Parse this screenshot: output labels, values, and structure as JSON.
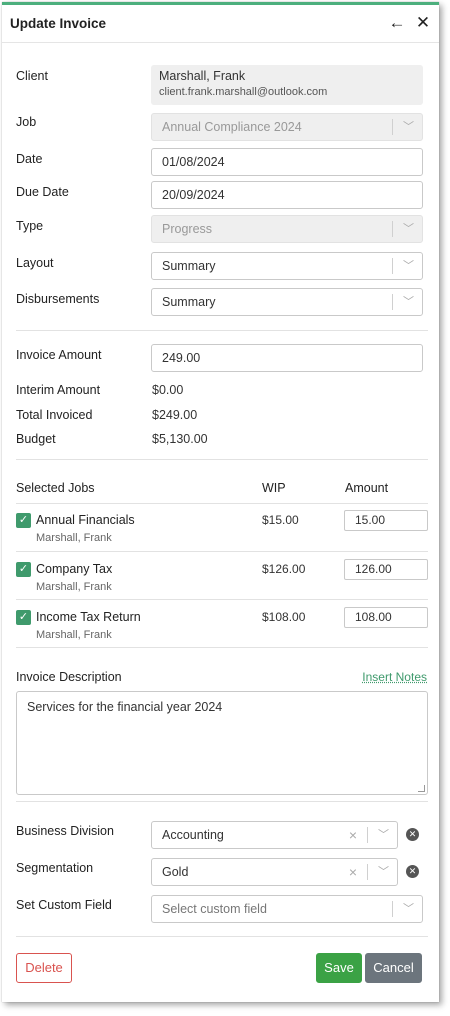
{
  "header": {
    "title": "Update Invoice",
    "back_icon": "arrow-left-icon",
    "close_icon": "close-icon"
  },
  "form": {
    "client_label": "Client",
    "client_name": "Marshall, Frank",
    "client_email": "client.frank.marshall@outlook.com",
    "job_label": "Job",
    "job_value": "Annual Compliance 2024",
    "date_label": "Date",
    "date_value": "01/08/2024",
    "due_date_label": "Due Date",
    "due_date_value": "20/09/2024",
    "type_label": "Type",
    "type_value": "Progress",
    "layout_label": "Layout",
    "layout_value": "Summary",
    "disbursements_label": "Disbursements",
    "disbursements_value": "Summary"
  },
  "amounts": {
    "invoice_amount_label": "Invoice Amount",
    "invoice_amount_value": "249.00",
    "interim_label": "Interim Amount",
    "interim_value": "$0.00",
    "total_label": "Total Invoiced",
    "total_value": "$249.00",
    "budget_label": "Budget",
    "budget_value": "$5,130.00"
  },
  "jobs": {
    "col_selected": "Selected Jobs",
    "col_wip": "WIP",
    "col_amount": "Amount",
    "rows": [
      {
        "name": "Annual Financials",
        "client": "Marshall, Frank",
        "wip": "$15.00",
        "amount": "15.00",
        "checked": true
      },
      {
        "name": "Company Tax",
        "client": "Marshall, Frank",
        "wip": "$126.00",
        "amount": "126.00",
        "checked": true
      },
      {
        "name": "Income Tax Return",
        "client": "Marshall, Frank",
        "wip": "$108.00",
        "amount": "108.00",
        "checked": true
      }
    ]
  },
  "description": {
    "label": "Invoice Description",
    "insert_notes": "Insert Notes",
    "text": "Services for the financial year  2024"
  },
  "extra": {
    "division_label": "Business Division",
    "division_value": "Accounting",
    "segmentation_label": "Segmentation",
    "segmentation_value": "Gold",
    "custom_label": "Set Custom Field",
    "custom_placeholder": "Select custom field"
  },
  "buttons": {
    "delete": "Delete",
    "save": "Save",
    "cancel": "Cancel"
  },
  "colors": {
    "accent": "#3f9a6c",
    "save": "#3ba245",
    "cancel": "#6c757d",
    "delete": "#d9534f"
  }
}
